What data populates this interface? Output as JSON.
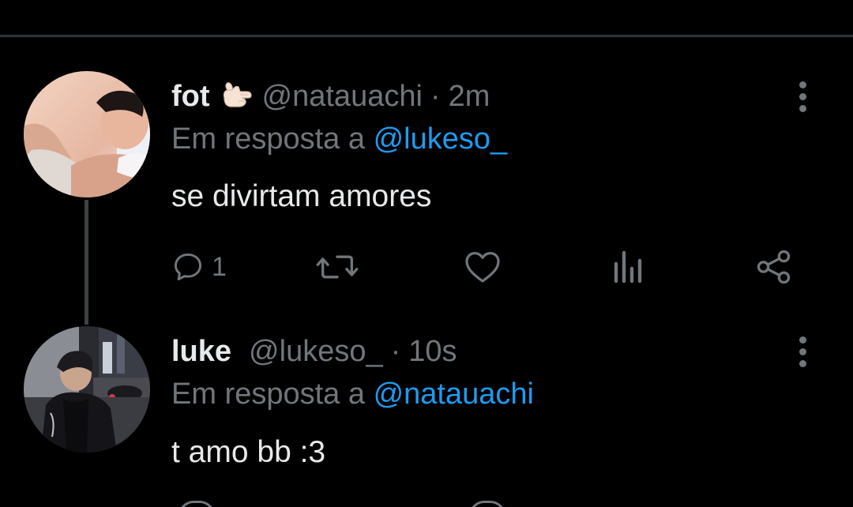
{
  "colors": {
    "background": "#000000",
    "text": "#e7e9ea",
    "secondary": "#71767b",
    "link": "#1d9bf0",
    "divider": "#2f3336",
    "thread_line": "#3e4144"
  },
  "tweets": [
    {
      "display_name": "fot",
      "emoji_icon": "call-me-hand-emoji",
      "handle": "@natauachi",
      "separator": "·",
      "time": "2m",
      "reply_prefix": "Em resposta a",
      "reply_mention": "@lukeso_",
      "text": "se divirtam amores",
      "actions": {
        "reply_count": "1",
        "reply_icon": "comment-icon",
        "retweet_icon": "retweet-icon",
        "like_icon": "heart-icon",
        "views_icon": "analytics-icon",
        "share_icon": "share-icon"
      }
    },
    {
      "display_name": "luke",
      "handle": "@lukeso_",
      "separator": "·",
      "time": "10s",
      "reply_prefix": "Em resposta a",
      "reply_mention": "@natauachi",
      "text": "t amo bb :3"
    }
  ]
}
